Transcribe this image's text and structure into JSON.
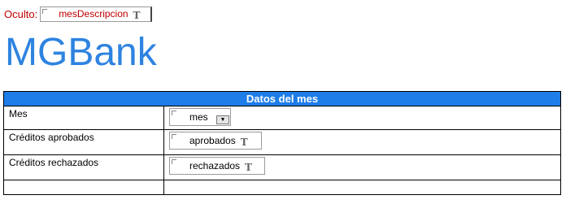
{
  "oculto": {
    "label": "Oculto:",
    "field_value": "mesDescripcion",
    "field_icon": "T"
  },
  "logo": {
    "text": "MGBank"
  },
  "table": {
    "header": "Datos del mes",
    "rows": [
      {
        "label": "Mes",
        "field_value": "mes",
        "field_icon": "dropdown-icon"
      },
      {
        "label": "Créditos aprobados",
        "field_value": "aprobados",
        "field_icon": "T"
      },
      {
        "label": "Créditos rechazados",
        "field_value": "rechazados",
        "field_icon": "T"
      },
      {
        "label": "",
        "field_value": ""
      }
    ]
  },
  "colors": {
    "accent": "#1e7de8",
    "logo": "#2e83e0",
    "oculto": "#c00000"
  }
}
